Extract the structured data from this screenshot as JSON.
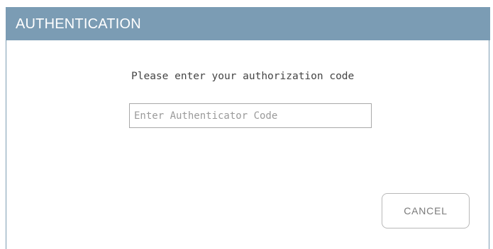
{
  "dialog": {
    "title": "AUTHENTICATION",
    "prompt": "Please enter your authorization code",
    "code_input": {
      "value": "",
      "placeholder": "Enter Authenticator Code"
    },
    "cancel_label": "CANCEL"
  },
  "colors": {
    "titlebar": "#7b9cb4",
    "title_text": "#ffffff",
    "border": "#7d9db3"
  }
}
